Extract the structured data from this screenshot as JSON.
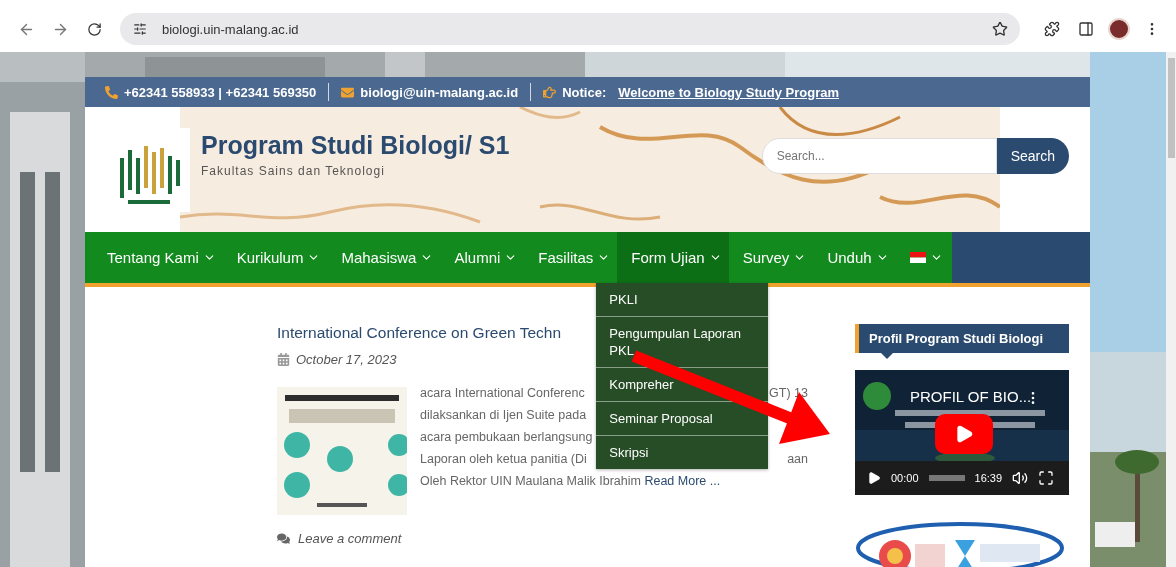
{
  "browser": {
    "url": "biologi.uin-malang.ac.id"
  },
  "topbar": {
    "phone": "+62341 558933 | +62341 569350",
    "email": "biologi@uin-malang.ac.id",
    "notice_label": "Notice:",
    "notice_link": "Welcome to Biology Study Program"
  },
  "site": {
    "title": "Program Studi Biologi/ S1",
    "subtitle": "Fakultas Sains dan Teknologi",
    "search_placeholder": "Search...",
    "search_button": "Search"
  },
  "nav": [
    {
      "kind": "text",
      "label": "Tentang Kami",
      "expanded": false
    },
    {
      "kind": "text",
      "label": "Kurikulum",
      "expanded": false
    },
    {
      "kind": "text",
      "label": "Mahasiswa",
      "expanded": false
    },
    {
      "kind": "text",
      "label": "Alumni",
      "expanded": false
    },
    {
      "kind": "text",
      "label": "Fasilitas",
      "expanded": false
    },
    {
      "kind": "text",
      "label": "Form Ujian",
      "expanded": true,
      "submenu": [
        "PKLI",
        "Pengumpulan Laporan PKL",
        "Kompreher",
        "Seminar Proposal",
        "Skripsi"
      ]
    },
    {
      "kind": "text",
      "label": "Survey",
      "expanded": false
    },
    {
      "kind": "text",
      "label": "Unduh",
      "expanded": false
    },
    {
      "kind": "flag",
      "expanded": false
    }
  ],
  "post": {
    "title": "International Conference on Green Techn",
    "date": "October 17, 2023",
    "excerpt": [
      {
        "left": "acara International Conferenc",
        "right": "GT) 13"
      },
      {
        "left": "dilaksankan di Ijen Suite pada"
      },
      {
        "left": "acara pembukaan berlangsung"
      },
      {
        "left": "Laporan oleh ketua panitia (Di",
        "right": "aan"
      },
      {
        "left": "Oleh Rektor UIN Maulana Malik Ibrahim",
        "link": "Read More ..."
      }
    ],
    "comment": "Leave a comment"
  },
  "sidebar": {
    "widget_title": "Profil Program Studi Biologi",
    "video": {
      "title": "PROFIL OF BIO...",
      "time_current": "00:00",
      "time_total": "16:39"
    }
  }
}
